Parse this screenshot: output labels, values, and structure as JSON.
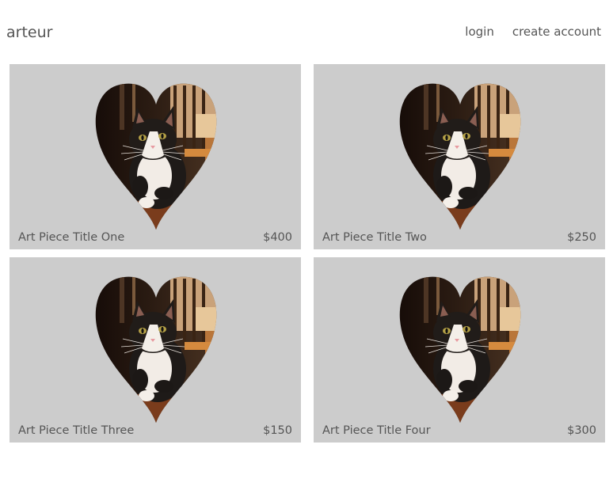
{
  "header": {
    "brand": "arteur",
    "nav": {
      "login": "login",
      "create_account": "create account"
    }
  },
  "listings": [
    {
      "title": "Art Piece Title One",
      "price": "$400",
      "image_icon": "heart-cat-image"
    },
    {
      "title": "Art Piece Title Two",
      "price": "$250",
      "image_icon": "heart-cat-image"
    },
    {
      "title": "Art Piece Title Three",
      "price": "$150",
      "image_icon": "heart-cat-image"
    },
    {
      "title": "Art Piece Title Four",
      "price": "$300",
      "image_icon": "heart-cat-image"
    }
  ],
  "colors": {
    "card_background": "#cccccc",
    "text": "#555555",
    "page_background": "#ffffff"
  }
}
